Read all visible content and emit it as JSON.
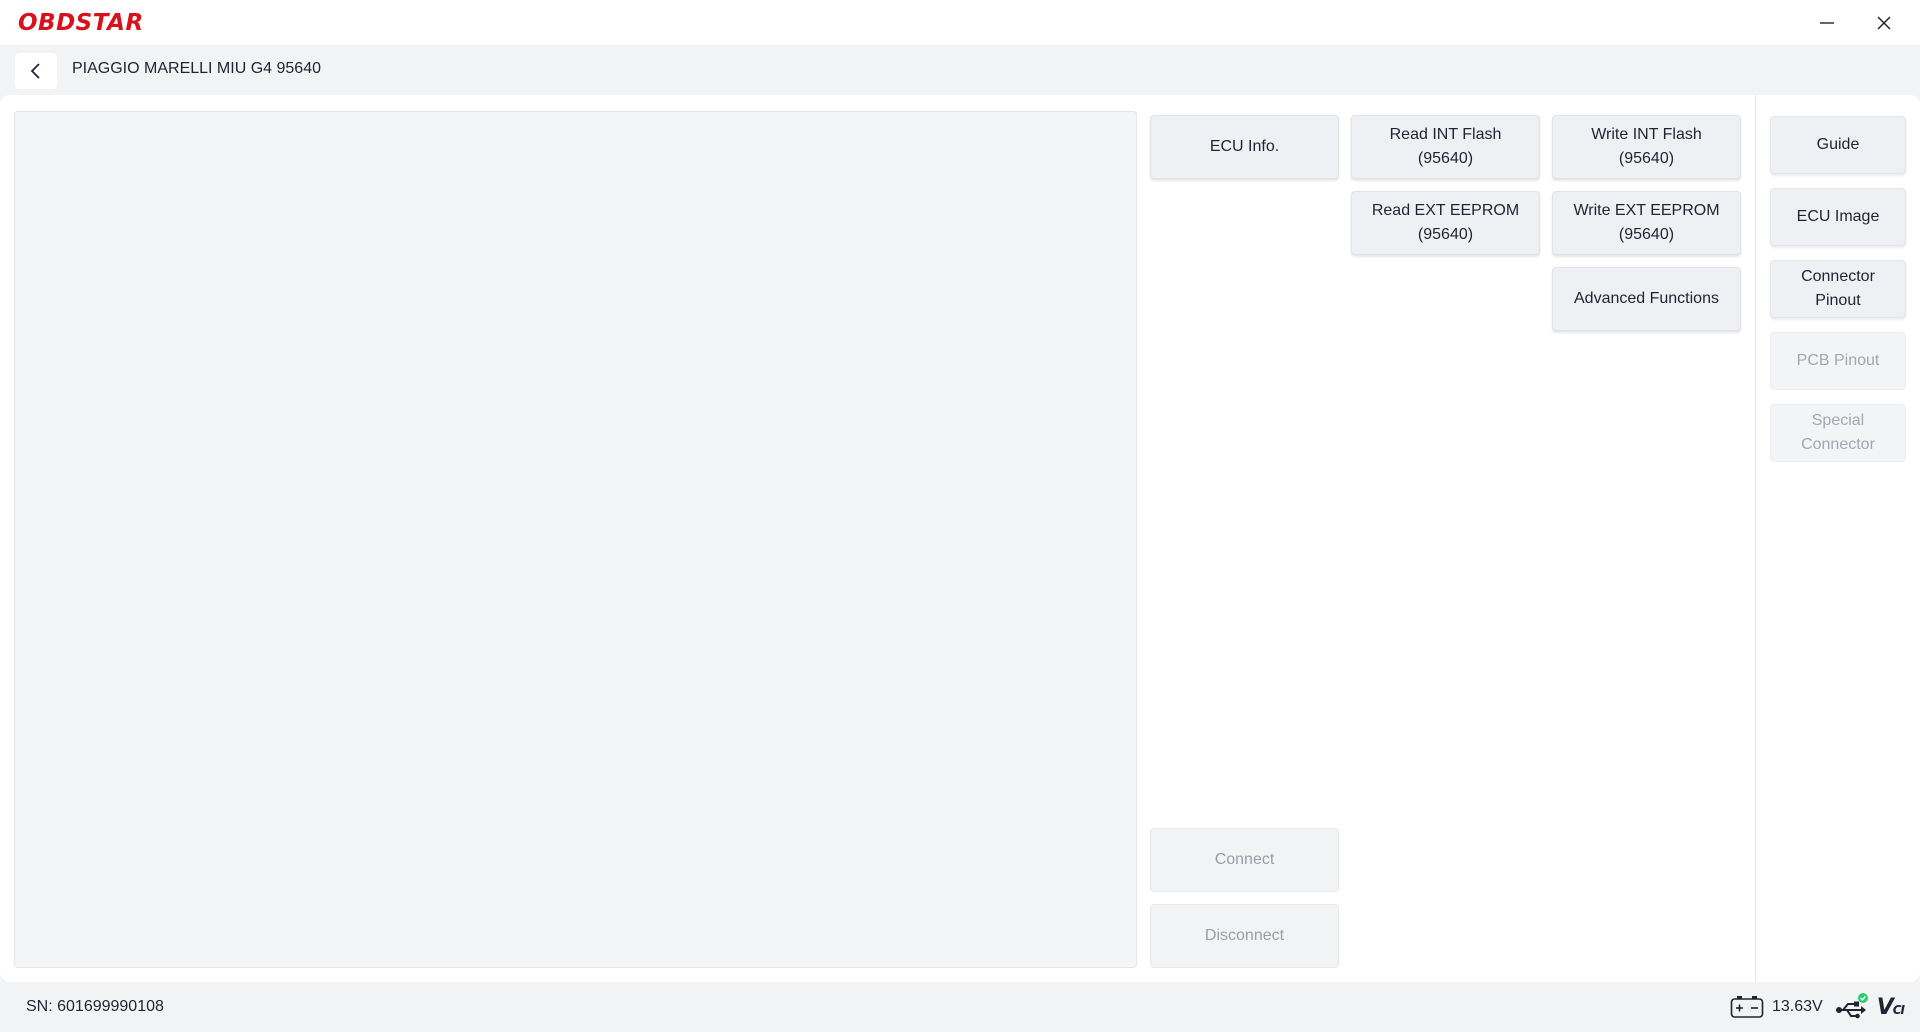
{
  "app": {
    "logo_text": "OBDSTAR",
    "brand_color": "#d7121d"
  },
  "window": {
    "minimize_icon": "minimize-icon",
    "close_icon": "close-icon"
  },
  "nav": {
    "back_icon": "chevron-left-icon",
    "title": "PIAGGIO MARELLI MIU G4 95640"
  },
  "functions": {
    "ecu_info": "ECU Info.",
    "read_int_flash": "Read INT Flash\n(95640)",
    "write_int_flash": "Write INT Flash\n(95640)",
    "read_ext_eeprom": "Read EXT EEPROM\n(95640)",
    "write_ext_eeprom": "Write EXT EEPROM\n(95640)",
    "advanced_functions": "Advanced Functions",
    "connect": "Connect",
    "disconnect": "Disconnect"
  },
  "sidebar": {
    "items": [
      {
        "label": "Guide",
        "enabled": true
      },
      {
        "label": "ECU Image",
        "enabled": true
      },
      {
        "label": "Connector\nPinout",
        "enabled": true
      },
      {
        "label": "PCB Pinout",
        "enabled": false
      },
      {
        "label": "Special\nConnector",
        "enabled": false
      }
    ]
  },
  "status": {
    "sn": "SN: 601699990108",
    "voltage": "13.63V",
    "battery_icon": "battery-icon",
    "usb_icon": "usb-connected-icon",
    "usb_status_color": "#2ecc71",
    "vci_label": "V",
    "vci_suffix": "CI"
  }
}
